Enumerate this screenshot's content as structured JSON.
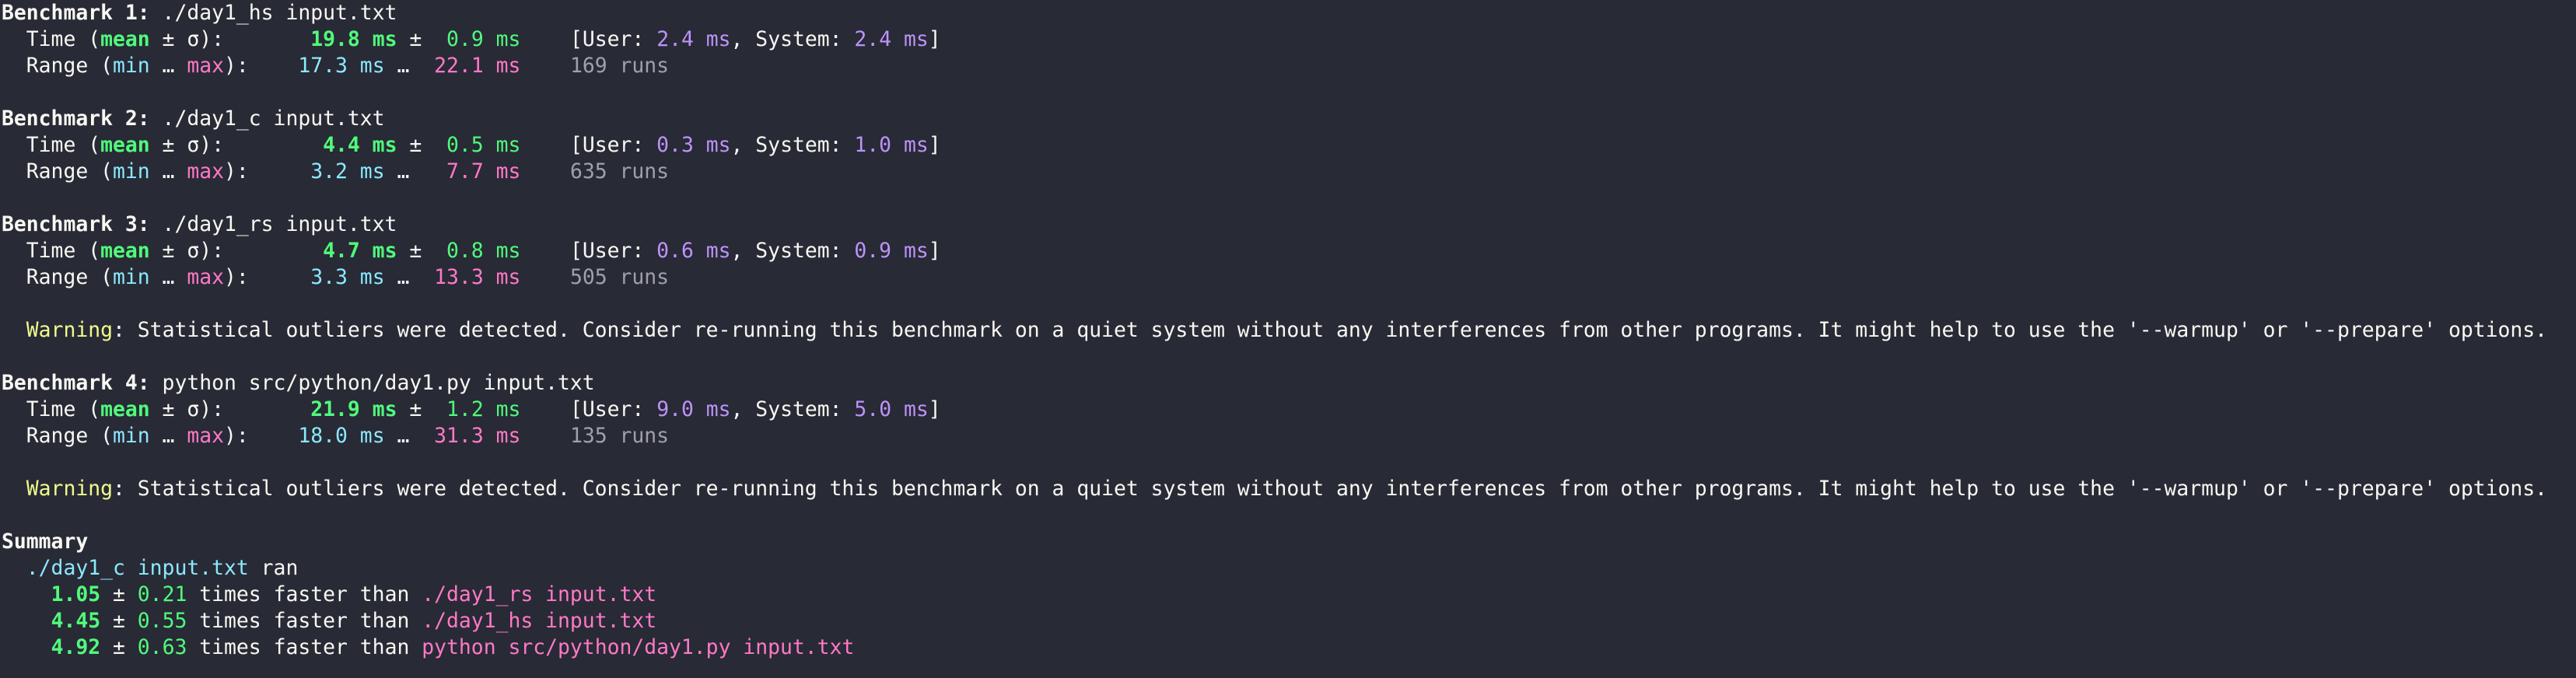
{
  "benchmarks": [
    {
      "header_label": "Benchmark 1:",
      "command": " ./day1_hs input.txt",
      "mean": "19.8 ms",
      "sigma": "0.9 ms",
      "user": "2.4 ms",
      "system": "2.4 ms",
      "min": "17.3 ms",
      "max": "22.1 ms",
      "runs": "169 runs"
    },
    {
      "header_label": "Benchmark 2:",
      "command": " ./day1_c input.txt",
      "mean": "4.4 ms",
      "sigma": "0.5 ms",
      "user": "0.3 ms",
      "system": "1.0 ms",
      "min": "3.2 ms",
      "max": "7.7 ms",
      "runs": "635 runs"
    },
    {
      "header_label": "Benchmark 3:",
      "command": " ./day1_rs input.txt",
      "mean": "4.7 ms",
      "sigma": "0.8 ms",
      "user": "0.6 ms",
      "system": "0.9 ms",
      "min": "3.3 ms",
      "max": "13.3 ms",
      "runs": "505 runs"
    },
    {
      "header_label": "Benchmark 4:",
      "command": " python src/python/day1.py input.txt",
      "mean": "21.9 ms",
      "sigma": "1.2 ms",
      "user": "9.0 ms",
      "system": "5.0 ms",
      "min": "18.0 ms",
      "max": "31.3 ms",
      "runs": "135 runs"
    }
  ],
  "labels": {
    "time_prefix": "  Time (",
    "mean_word": "mean",
    "pm_sigma": " ± σ):",
    "range_prefix": "  Range (",
    "min_word": "min",
    "ellipsis": " … ",
    "max_word": "max",
    "range_close": "):",
    "pm": " ±  ",
    "range_sep": " … ",
    "user_open": "[User: ",
    "system_sep": ", System: ",
    "bracket_close": "]"
  },
  "warning": {
    "label": "Warning",
    "text": ": Statistical outliers were detected. Consider re-running this benchmark on a quiet system without any interferences from other programs. It might help to use the '--warmup' or '--prepare' options."
  },
  "summary": {
    "title": "Summary",
    "fastest_command": "./day1_c input.txt",
    "ran_word": " ran",
    "times_faster": " times faster than ",
    "comparisons": [
      {
        "ratio": "1.05",
        "error": "0.21",
        "command": "./day1_rs input.txt"
      },
      {
        "ratio": "4.45",
        "error": "0.55",
        "command": "./day1_hs input.txt"
      },
      {
        "ratio": "4.92",
        "error": "0.63",
        "command": "python src/python/day1.py input.txt"
      }
    ],
    "pm": " ± "
  },
  "colors": {
    "background": "#282a36",
    "foreground": "#f8f8f2",
    "green": "#50fa7b",
    "cyan": "#8be9fd",
    "pink": "#ff79c6",
    "purple": "#bd93f9",
    "gray": "#a0a1a7",
    "yellow": "#f1fa8c"
  }
}
